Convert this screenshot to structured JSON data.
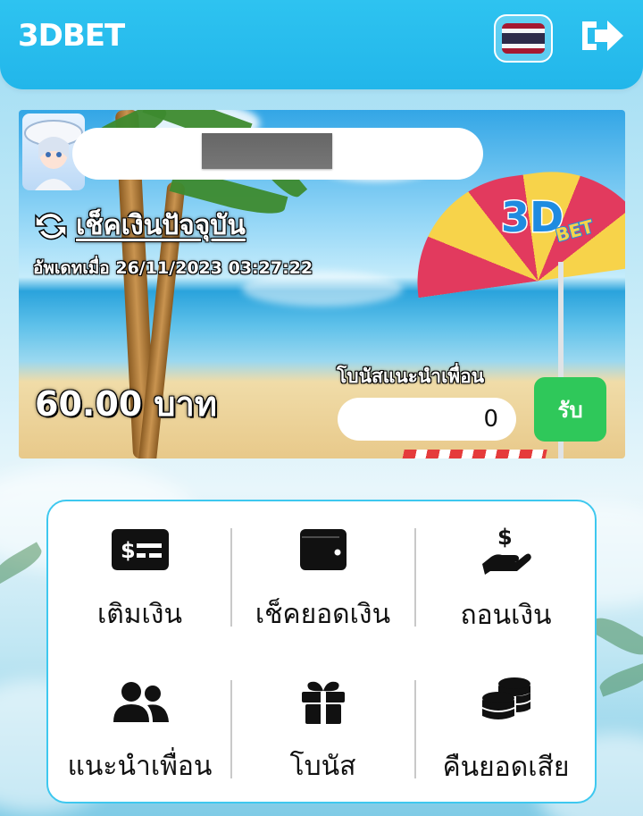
{
  "header": {
    "logo": "3DBET",
    "flag_label": "Thai flag",
    "logout_label": "logout"
  },
  "banner": {
    "check_title": "เช็คเงินปัจจุบัน",
    "updated_label": "อัพเดทเมื่อ",
    "updated_value": "26/11/2023 03:27:22",
    "balance": "60.00 บาท",
    "referral_label": "โบนัสแนะนำเพื่อน",
    "referral_value": "0",
    "claim_label": "รับ",
    "brand_logo": "3D BET"
  },
  "menu": {
    "items": [
      {
        "label": "เติมเงิน",
        "icon": "money-bill-icon"
      },
      {
        "label": "เช็คยอดเงิน",
        "icon": "wallet-icon"
      },
      {
        "label": "ถอนเงิน",
        "icon": "hand-dollar-icon"
      },
      {
        "label": "แนะนำเพื่อน",
        "icon": "users-icon"
      },
      {
        "label": "โบนัส",
        "icon": "gift-icon"
      },
      {
        "label": "คืนยอดเสีย",
        "icon": "coins-icon"
      }
    ]
  },
  "colors": {
    "header": "#22b6ea",
    "accent_border": "#3ec8ef",
    "claim_button": "#2fc85a"
  }
}
